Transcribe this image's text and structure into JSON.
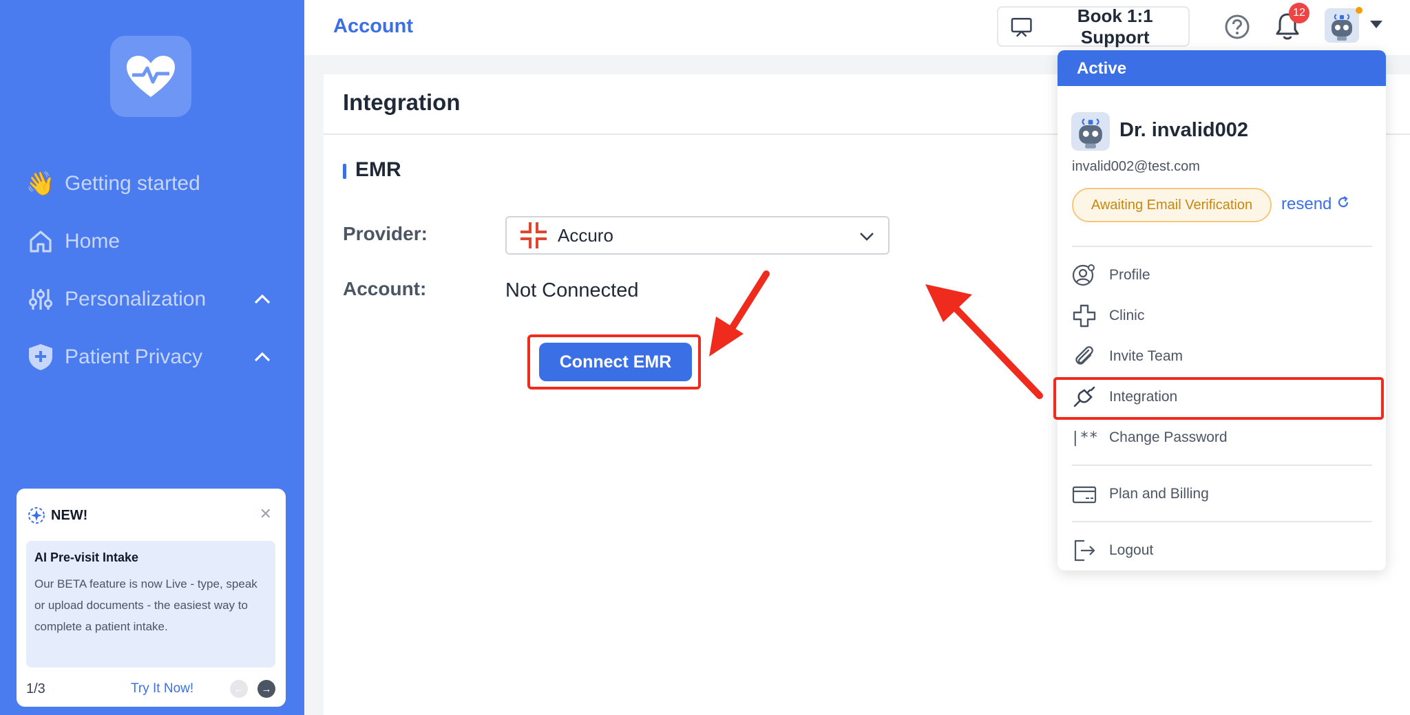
{
  "sidebar": {
    "items": [
      {
        "label": "Getting started",
        "icon": "wave-hand-icon"
      },
      {
        "label": "Home",
        "icon": "home-icon"
      },
      {
        "label": "Personalization",
        "icon": "sliders-icon"
      },
      {
        "label": "Patient Privacy",
        "icon": "shield-plus-icon"
      }
    ],
    "announcement": {
      "badge": "NEW!",
      "title": "AI Pre-visit Intake",
      "text": "Our BETA feature is now Live - type, speak or upload documents - the easiest way to complete a patient intake.",
      "page": "1/3",
      "cta": "Try It Now!"
    }
  },
  "header": {
    "title": "Account",
    "support_label": "Book 1:1 Support",
    "notification_count": "12"
  },
  "main": {
    "title": "Integration",
    "section": "EMR",
    "provider_label": "Provider:",
    "provider_value": "Accuro",
    "account_label": "Account:",
    "account_value": "Not Connected",
    "connect_label": "Connect EMR"
  },
  "dropdown": {
    "status": "Active",
    "name": "Dr. invalid002",
    "email": "invalid002@test.com",
    "badge": "Awaiting Email Verification",
    "resend": "resend",
    "items": [
      {
        "label": "Profile",
        "icon": "user-gear-icon"
      },
      {
        "label": "Clinic",
        "icon": "medical-cross-icon"
      },
      {
        "label": "Invite Team",
        "icon": "paperclip-icon"
      },
      {
        "label": "Integration",
        "icon": "plug-icon"
      },
      {
        "label": "Change Password",
        "icon": "password-icon"
      },
      {
        "label": "Plan and Billing",
        "icon": "credit-card-icon"
      },
      {
        "label": "Logout",
        "icon": "logout-icon"
      }
    ]
  },
  "colors": {
    "brand": "#4a7cf0",
    "accent": "#3b6fe6",
    "highlight": "#ef2b1d",
    "warning": "#c8860d"
  }
}
